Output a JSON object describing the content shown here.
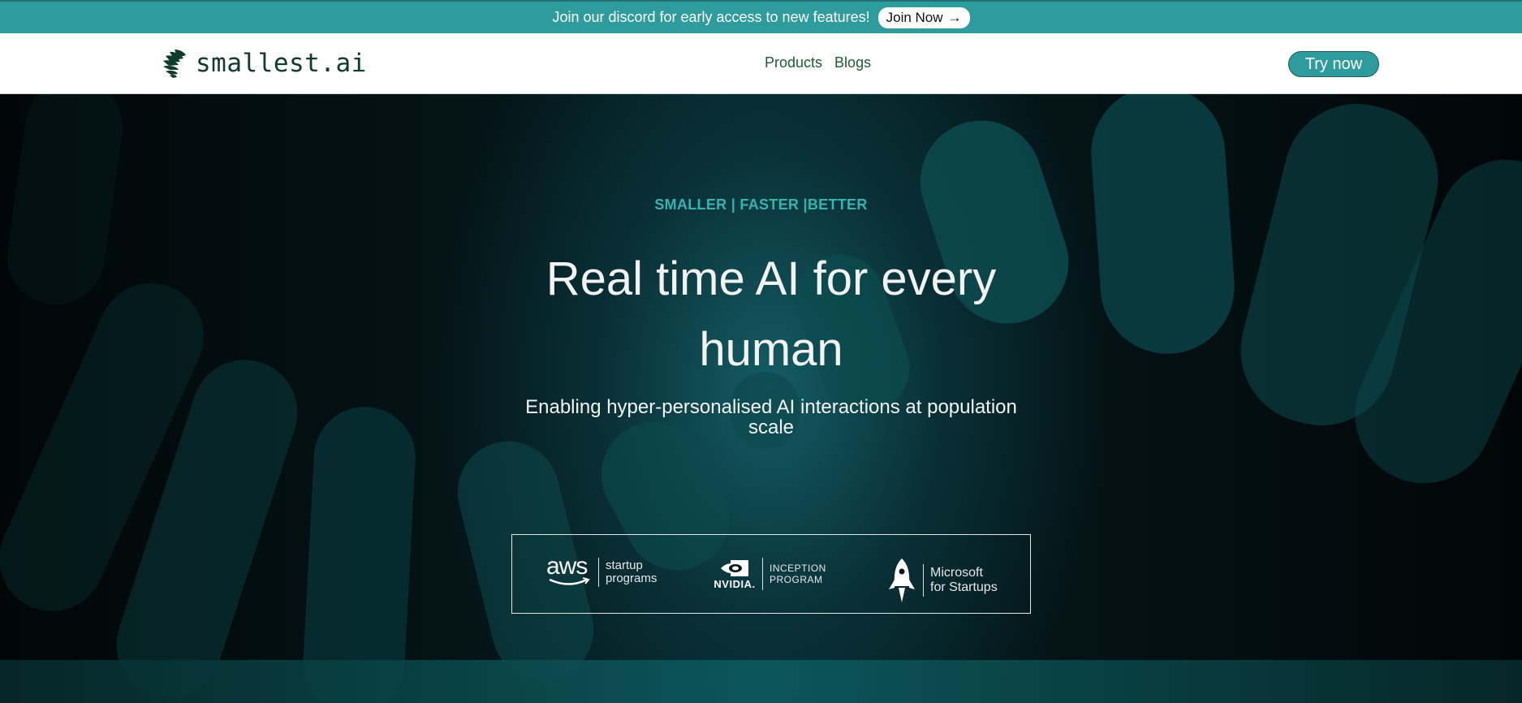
{
  "announcement": {
    "text": "Join our discord for early access to new features!",
    "button_label": "Join Now",
    "button_arrow": "→"
  },
  "nav": {
    "logo_text": "smallest.ai",
    "links": [
      "Products",
      "Blogs"
    ],
    "cta_label": "Try now"
  },
  "hero": {
    "eyebrow": "SMALLER | FASTER |BETTER",
    "headline": "Real time AI for every human",
    "subheadline": "Enabling hyper-personalised AI interactions at population scale"
  },
  "partners": {
    "aws": {
      "mark": "aws",
      "line1": "startup",
      "line2": "programs"
    },
    "nvidia": {
      "mark": "NVIDIA.",
      "line1": "INCEPTION",
      "line2": "PROGRAM"
    },
    "microsoft": {
      "line1": "Microsoft",
      "line2": "for Startups"
    }
  },
  "colors": {
    "announcement_bg": "#2e9b9c",
    "accent_teal": "#36b3b0",
    "nav_link": "#1f5c33",
    "logo_dark": "#0f3b2c"
  }
}
